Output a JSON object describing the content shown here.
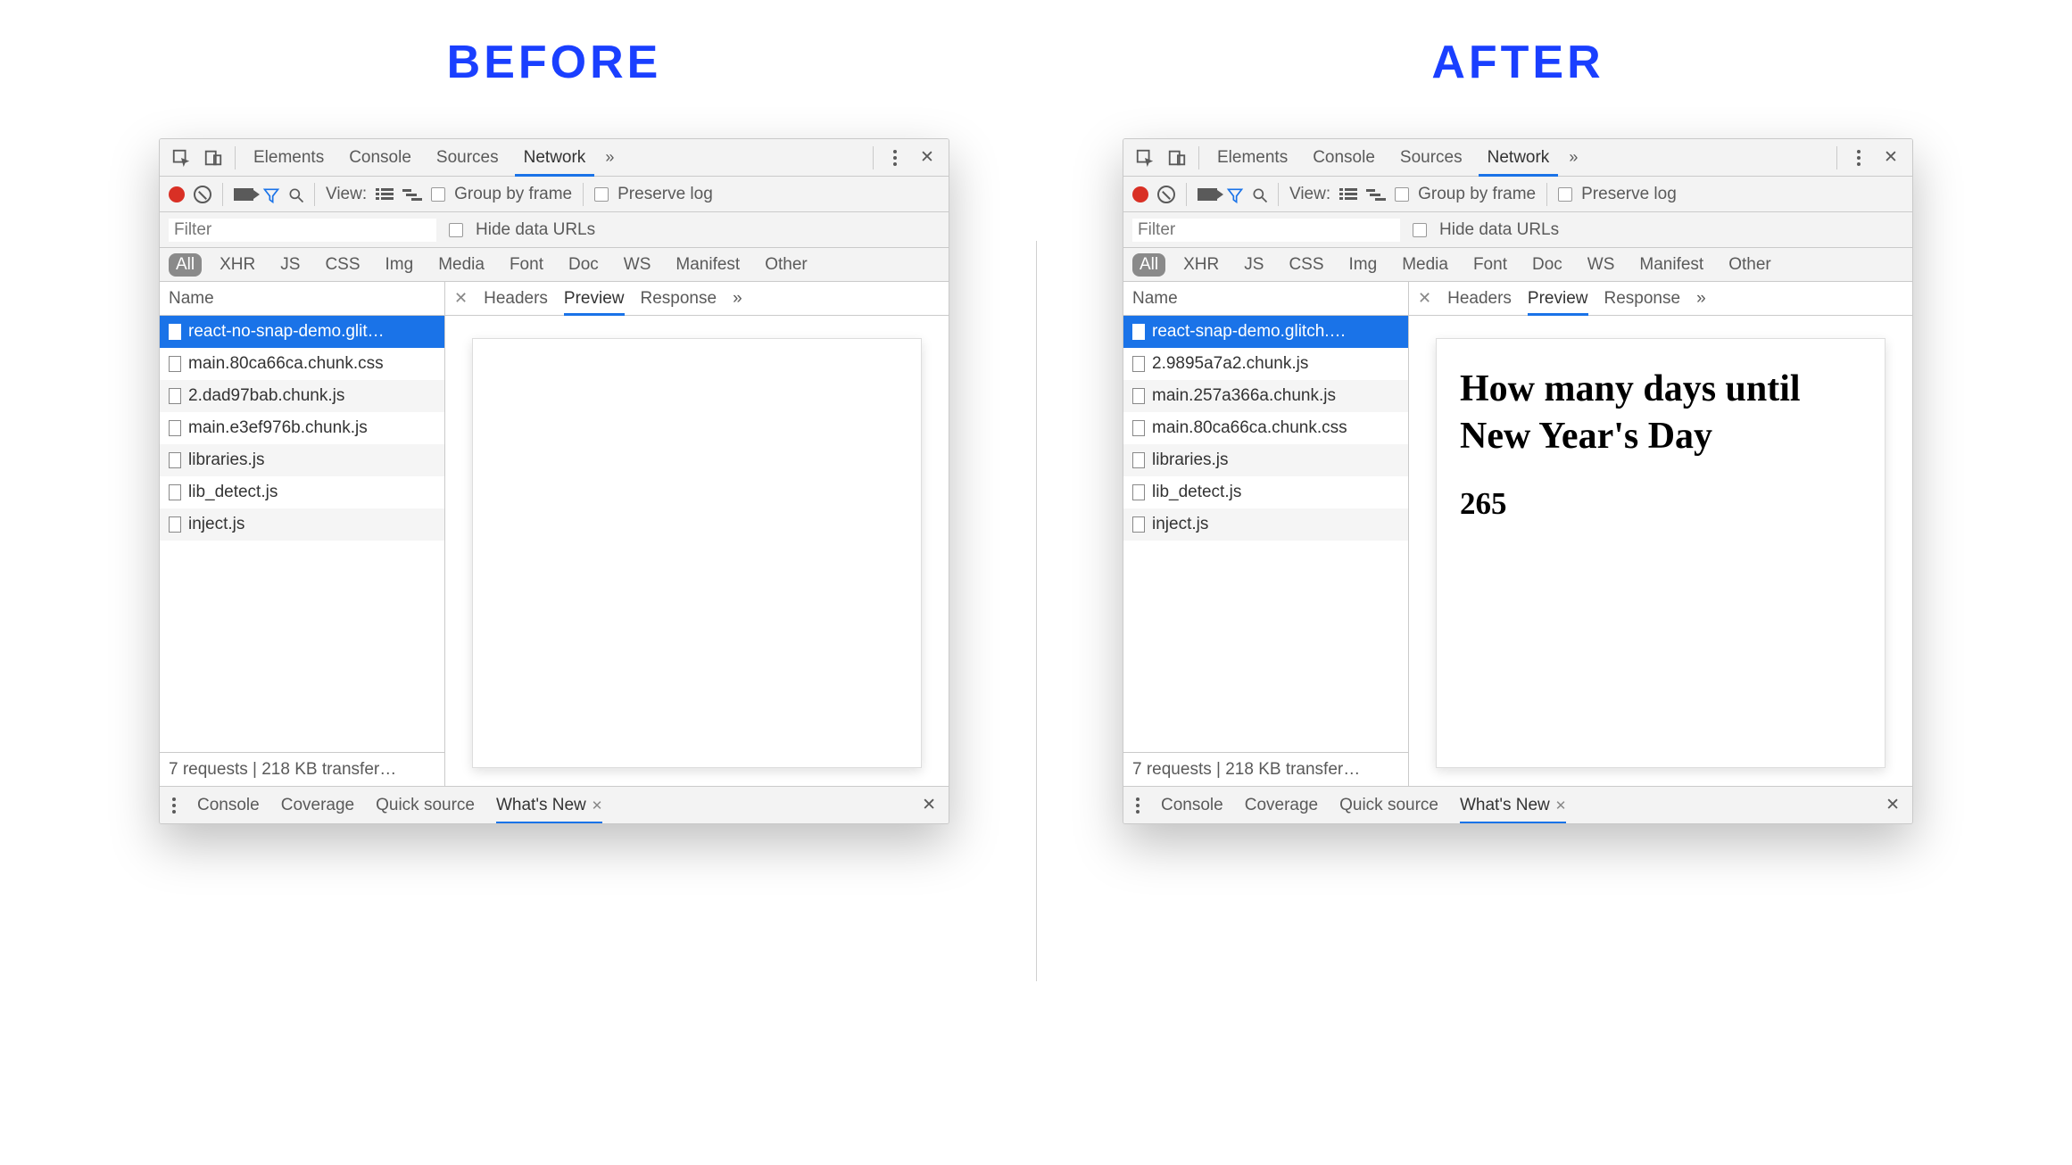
{
  "labels": {
    "before": "BEFORE",
    "after": "AFTER"
  },
  "top_tabs": {
    "items": [
      "Elements",
      "Console",
      "Sources",
      "Network"
    ],
    "active": "Network"
  },
  "sub_toolbar": {
    "view_label": "View:",
    "group_by_frame": "Group by frame",
    "preserve_log": "Preserve log"
  },
  "filter": {
    "placeholder": "Filter",
    "hide_data_urls": "Hide data URLs"
  },
  "type_chips": [
    "All",
    "XHR",
    "JS",
    "CSS",
    "Img",
    "Media",
    "Font",
    "Doc",
    "WS",
    "Manifest",
    "Other"
  ],
  "left_header": "Name",
  "right_tabs": {
    "items": [
      "Headers",
      "Preview",
      "Response"
    ],
    "active": "Preview"
  },
  "status_line": "7 requests | 218 KB transfer…",
  "drawer": {
    "items": [
      "Console",
      "Coverage",
      "Quick source",
      "What's New"
    ],
    "active": "What's New"
  },
  "before": {
    "requests": [
      "react-no-snap-demo.glit…",
      "main.80ca66ca.chunk.css",
      "2.dad97bab.chunk.js",
      "main.e3ef976b.chunk.js",
      "libraries.js",
      "lib_detect.js",
      "inject.js"
    ],
    "selected_index": 0,
    "preview": {
      "title": "",
      "value": ""
    }
  },
  "after": {
    "requests": [
      "react-snap-demo.glitch.…",
      "2.9895a7a2.chunk.js",
      "main.257a366a.chunk.js",
      "main.80ca66ca.chunk.css",
      "libraries.js",
      "lib_detect.js",
      "inject.js"
    ],
    "selected_index": 0,
    "preview": {
      "title": "How many days until New Year's Day",
      "value": "265"
    }
  }
}
